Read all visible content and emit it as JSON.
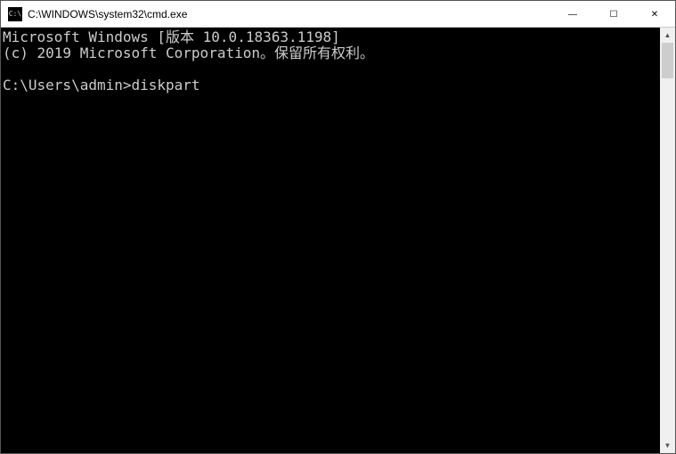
{
  "titlebar": {
    "icon_label": "C:\\",
    "title": "C:\\WINDOWS\\system32\\cmd.exe"
  },
  "window_controls": {
    "minimize": "—",
    "maximize": "☐",
    "close": "✕"
  },
  "terminal": {
    "line1": "Microsoft Windows [版本 10.0.18363.1198]",
    "line2": "(c) 2019 Microsoft Corporation。保留所有权利。",
    "blank": "",
    "prompt": "C:\\Users\\admin>",
    "command": "diskpart"
  },
  "scrollbar": {
    "up": "▲",
    "down": "▼"
  }
}
